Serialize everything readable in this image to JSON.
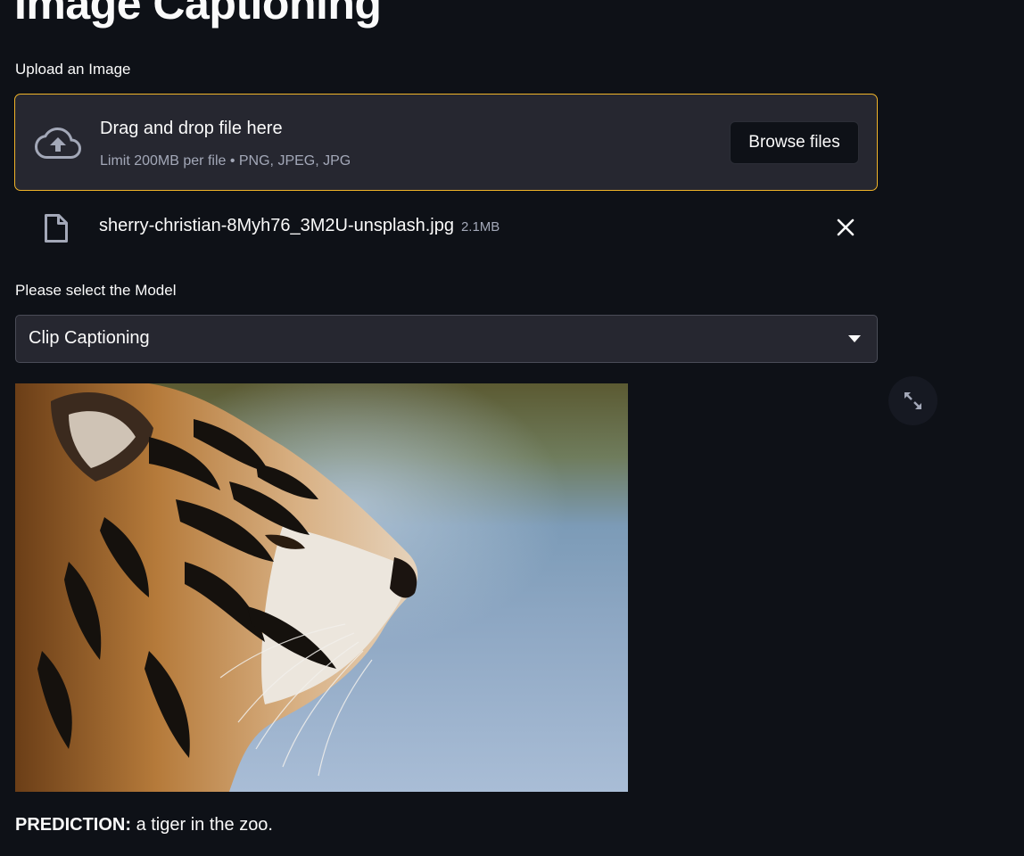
{
  "page": {
    "title": "Image Captioning"
  },
  "uploader": {
    "label": "Upload an Image",
    "drop_title": "Drag and drop file here",
    "limit_text": "Limit 200MB per file • PNG, JPEG, JPG",
    "browse_label": "Browse files",
    "icon": "cloud-upload-icon"
  },
  "uploaded_file": {
    "name": "sherry-christian-8Myh76_3M2U-unsplash.jpg",
    "size": "2.1MB",
    "icon": "file-icon",
    "remove_icon": "close-icon"
  },
  "model_select": {
    "label": "Please select the Model",
    "value": "Clip Captioning",
    "icon": "chevron-down-icon"
  },
  "image": {
    "icon": "fullscreen-icon"
  },
  "prediction": {
    "label": "PREDICTION:",
    "text": "a tiger in the zoo."
  },
  "colors": {
    "background": "#0e1117",
    "surface": "#262730",
    "focus_border": "#f0b429",
    "muted_text": "#a3a8b8"
  }
}
